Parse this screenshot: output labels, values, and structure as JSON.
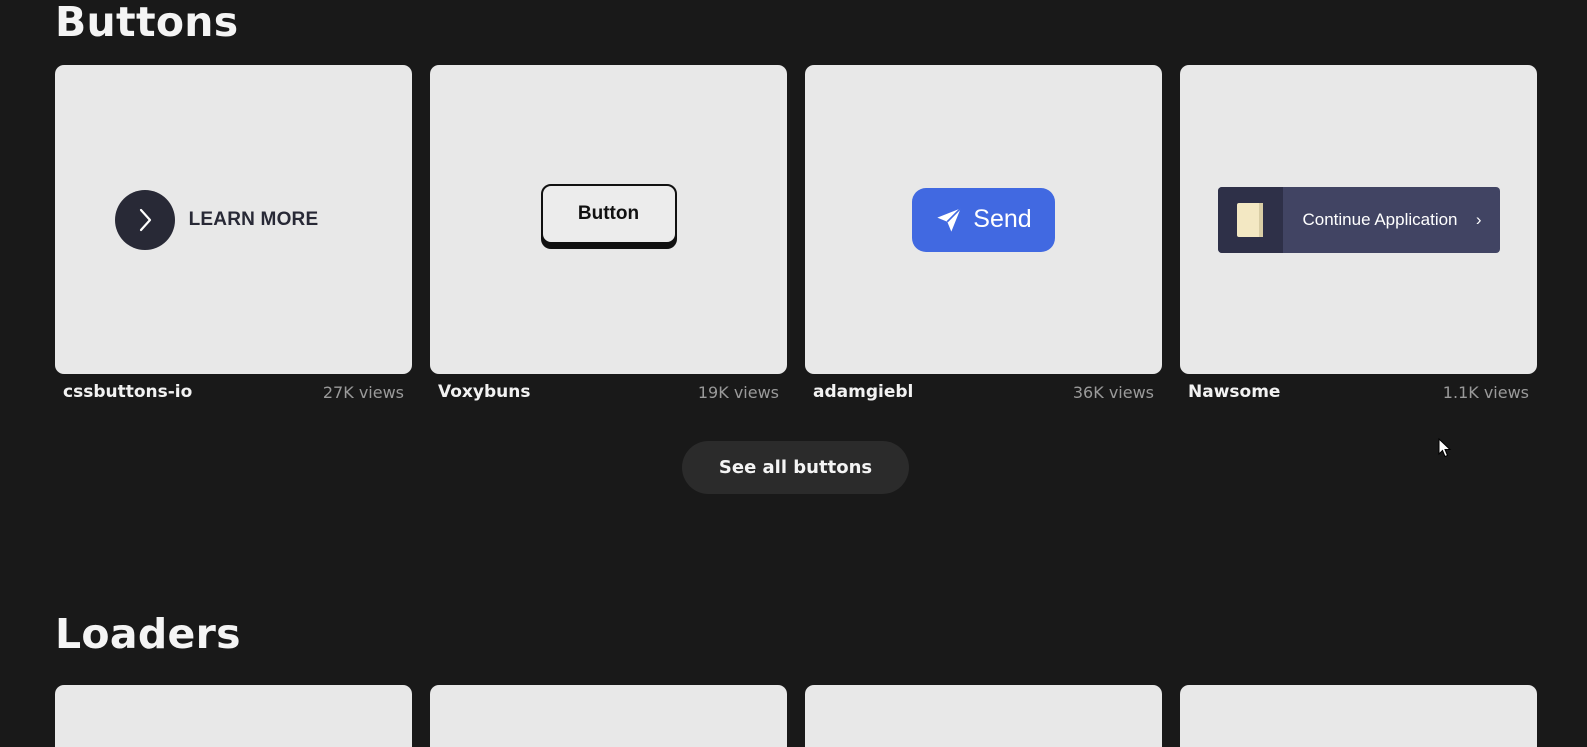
{
  "sections": {
    "buttons_title": "Buttons",
    "loaders_title": "Loaders"
  },
  "cards": [
    {
      "author": "cssbuttons-io",
      "views": "27K views",
      "preview_label": "LEARN MORE",
      "icon": "chevron-right-icon"
    },
    {
      "author": "Voxybuns",
      "views": "19K views",
      "preview_label": "Button"
    },
    {
      "author": "adamgiebl",
      "views": "36K views",
      "preview_label": "Send",
      "icon": "paper-plane-icon",
      "accent": "#4169e1"
    },
    {
      "author": "Nawsome",
      "views": "1.1K views",
      "preview_label": "Continue Application",
      "icon": "document-icon",
      "arrow": "›"
    }
  ],
  "see_all_label": "See all buttons",
  "colors": {
    "background": "#191919",
    "card": "#e8e8e8",
    "see_all_bg": "#2b2b2b"
  }
}
